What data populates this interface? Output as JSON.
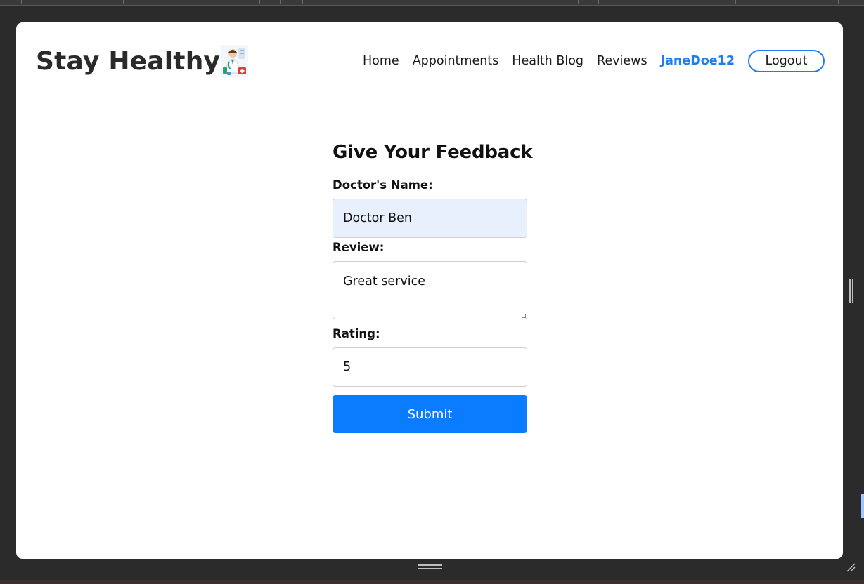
{
  "app": {
    "brand_name": "Stay Healthy",
    "brand_logo_icon": "doctor-icon"
  },
  "nav": {
    "items": [
      "Home",
      "Appointments",
      "Health Blog",
      "Reviews"
    ],
    "username": "JaneDoe12",
    "logout_label": "Logout"
  },
  "feedback_form": {
    "title": "Give Your Feedback",
    "doctor_label": "Doctor's Name:",
    "doctor_value": "Doctor Ben",
    "review_label": "Review:",
    "review_value": "Great service",
    "rating_label": "Rating:",
    "rating_value": "5",
    "submit_label": "Submit"
  },
  "colors": {
    "accent": "#0a7cff",
    "username": "#1e7ef0",
    "autofill_bg": "#e8f0fe",
    "window_frame": "#2b2b2b"
  }
}
